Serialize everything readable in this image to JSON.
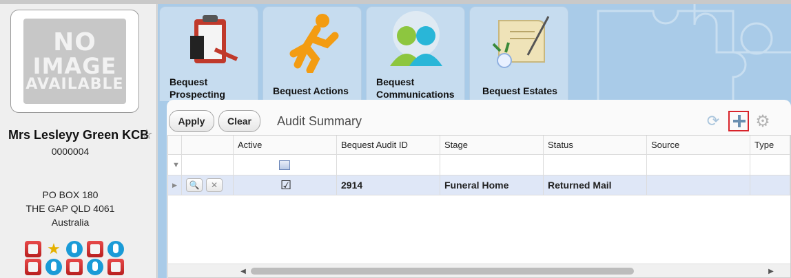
{
  "contact": {
    "photo_text": [
      "NO",
      "IMAGE",
      "AVAILABLE"
    ],
    "name": "Mrs Lesleyy Green KCB",
    "id": "0000004",
    "address": [
      "PO BOX 180",
      "THE GAP QLD 4061",
      "Australia"
    ],
    "badge_icons": [
      "document-icon",
      "award-star-icon",
      "hand-icon",
      "document-icon",
      "hand-icon",
      "document-icon",
      "hand-icon",
      "document-icon",
      "hand-icon",
      "document-icon"
    ]
  },
  "tabs": [
    {
      "label": "Bequest Prospecting",
      "icon": "clipboard-icon"
    },
    {
      "label": "Bequest Actions",
      "icon": "running-man-icon"
    },
    {
      "label": "Bequest Communications",
      "icon": "people-icon"
    },
    {
      "label": "Bequest Estates",
      "icon": "will-scroll-icon"
    }
  ],
  "toolbar": {
    "apply_label": "Apply",
    "clear_label": "Clear",
    "title": "Audit Summary"
  },
  "grid": {
    "columns": [
      "Active",
      "Bequest Audit ID",
      "Stage",
      "Status",
      "Source",
      "Type"
    ],
    "rows": [
      {
        "active": true,
        "audit_id": "2914",
        "stage": "Funeral Home",
        "status": "Returned Mail",
        "source": "",
        "type": ""
      }
    ]
  },
  "colors": {
    "accent_blue": "#a9cbe8",
    "tab_bg": "#c6dcef",
    "selected_row": "#dfe7f7",
    "highlight_red": "#d8232a"
  }
}
